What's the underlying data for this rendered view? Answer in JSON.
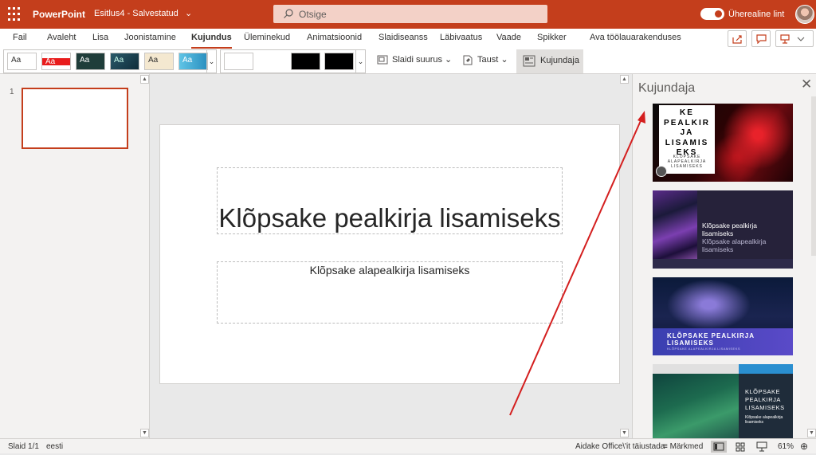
{
  "app": {
    "name": "PowerPoint",
    "document": "Esitlus4 - Salvestatud",
    "search_placeholder": "Otsige",
    "toggle_label": "Üherealine lint"
  },
  "tabs": [
    "Fail",
    "Avaleht",
    "Lisa",
    "Joonistamine",
    "Kujundus",
    "Üleminekud",
    "Animatsioonid",
    "Slaidiseanss",
    "Läbivaatus",
    "Vaade",
    "Spikker",
    "Ava töölauarakenduses"
  ],
  "active_tab": "Kujundus",
  "ribbon": {
    "theme_sample": "Aa",
    "slide_size": "Slaidi suurus",
    "background": "Taust",
    "designer": "Kujundaja"
  },
  "thumbs": {
    "slide_number": "1"
  },
  "slide": {
    "title_placeholder": "Klõpsake pealkirja lisamiseks",
    "subtitle_placeholder": "Klõpsake alapealkirja lisamiseks"
  },
  "designer": {
    "title": "Kujundaja",
    "card1_title": "KE\nPEALKIR\nJA\nLISAMIS\nEKS",
    "card1_sub": "KLÕPSAKE\nALAPEALKIRJA\nLISAMISEKS",
    "card2_title": "Klõpsake pealkirja lisamiseks",
    "card2_sub": "Klõpsake alapealkirja lisamiseks",
    "card3_title": "KLÕPSAKE PEALKIRJA\nLISAMISEKS",
    "card3_sub": "KLÕPSAKE ALAPEALKIRJA LISAMISEKS",
    "card4_title": "KLÕPSAKE\nPEALKIRJA\nLISAMISEKS",
    "card4_sub": "Klõpsake alapealkirja\nlisamiseks"
  },
  "status": {
    "slide": "Slaid 1/1",
    "language": "eesti",
    "help": "Aidake Office\\'it täiustada",
    "notes": "Märkmed",
    "zoom": "61%"
  },
  "colors": {
    "brand": "#c43e1c",
    "arrow": "#d41f1f"
  }
}
